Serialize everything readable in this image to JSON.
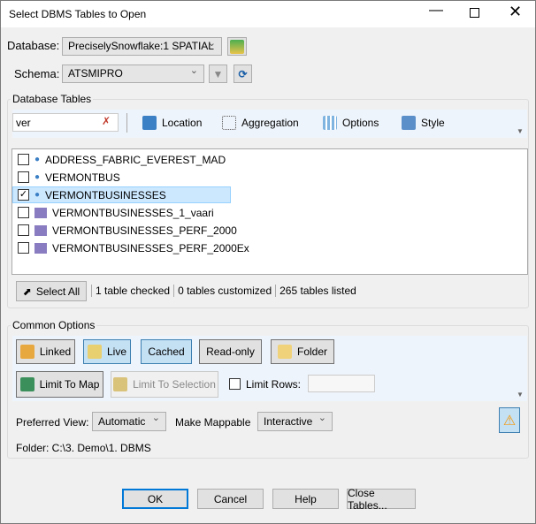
{
  "window": {
    "title": "Select DBMS Tables to Open"
  },
  "database": {
    "label": "Database:",
    "value": "PreciselySnowflake:1 SPATIAL"
  },
  "schema": {
    "label": "Schema:",
    "value": "ATSMIPRO"
  },
  "tables_group": {
    "label": "Database Tables",
    "search_value": "ver",
    "toolbar": {
      "location": "Location",
      "aggregation": "Aggregation",
      "options": "Options",
      "style": "Style"
    },
    "rows": [
      {
        "name": "ADDRESS_FABRIC_EVEREST_MAD",
        "checked": false,
        "icon": "point-icon"
      },
      {
        "name": "VERMONTBUS",
        "checked": false,
        "icon": "point-icon"
      },
      {
        "name": "VERMONTBUSINESSES",
        "checked": true,
        "icon": "point-icon"
      },
      {
        "name": "VERMONTBUSINESSES_1_vaari",
        "checked": false,
        "icon": "region-icon"
      },
      {
        "name": "VERMONTBUSINESSES_PERF_2000",
        "checked": false,
        "icon": "region-icon"
      },
      {
        "name": "VERMONTBUSINESSES_PERF_2000Ex",
        "checked": false,
        "icon": "region-icon"
      }
    ],
    "select_all": "Select All",
    "status": [
      "1 table checked",
      "0 tables customized",
      "265 tables listed"
    ]
  },
  "common": {
    "label": "Common Options",
    "linked": "Linked",
    "live": "Live",
    "cached": "Cached",
    "readonly": "Read-only",
    "folder": "Folder",
    "limit_map": "Limit To Map",
    "limit_selection": "Limit To Selection",
    "limit_rows": "Limit Rows:",
    "limit_rows_value": "",
    "preferred_view_label": "Preferred View:",
    "preferred_view": "Automatic",
    "make_mappable_label": "Make Mappable",
    "make_mappable": "Interactive",
    "folder_path": "Folder: C:\\3. Demo\\1. DBMS"
  },
  "buttons": {
    "ok": "OK",
    "cancel": "Cancel",
    "help": "Help",
    "close_tables": "Close Tables..."
  }
}
